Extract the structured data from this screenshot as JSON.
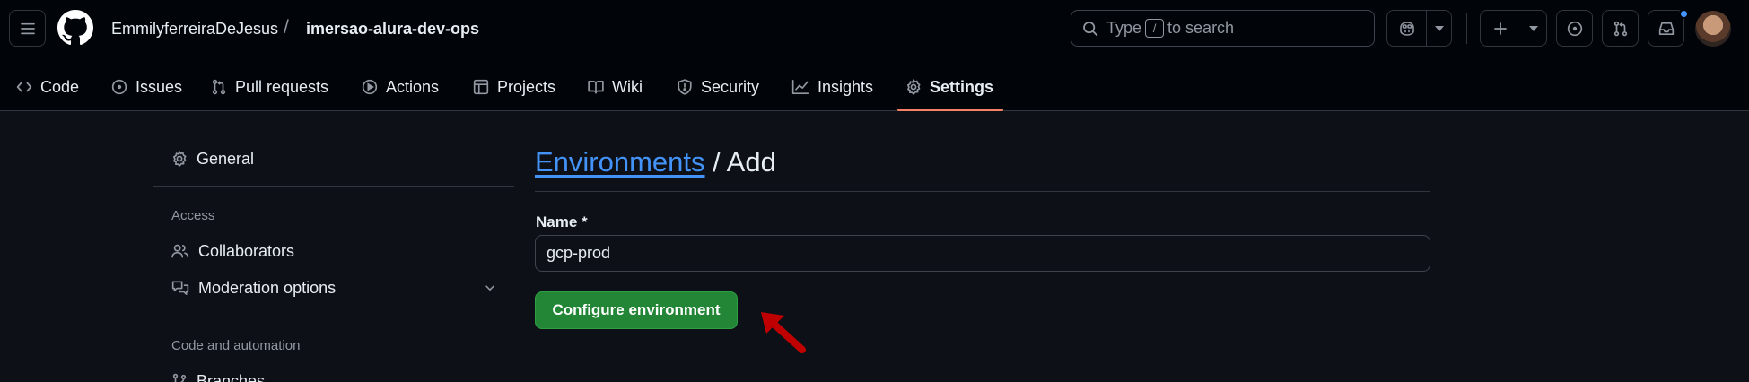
{
  "header": {
    "owner": "EmmilyferreiraDeJesus",
    "separator": "/",
    "repo": "imersao-alura-dev-ops",
    "search_prefix": "Type",
    "search_key": "/",
    "search_suffix": "to search"
  },
  "tabs": [
    {
      "label": "Code",
      "icon": "code-icon"
    },
    {
      "label": "Issues",
      "icon": "issue-opened-icon"
    },
    {
      "label": "Pull requests",
      "icon": "git-pull-request-icon"
    },
    {
      "label": "Actions",
      "icon": "play-icon"
    },
    {
      "label": "Projects",
      "icon": "table-icon"
    },
    {
      "label": "Wiki",
      "icon": "book-icon"
    },
    {
      "label": "Security",
      "icon": "shield-icon"
    },
    {
      "label": "Insights",
      "icon": "graph-icon"
    },
    {
      "label": "Settings",
      "icon": "gear-icon",
      "active": true
    }
  ],
  "sidebar": {
    "general": "General",
    "access_heading": "Access",
    "collaborators": "Collaborators",
    "moderation": "Moderation options",
    "code_heading": "Code and automation",
    "branches": "Branches"
  },
  "main": {
    "breadcrumb_link": "Environments",
    "breadcrumb_rest": " / Add",
    "name_label": "Name *",
    "name_value": "gcp-prod",
    "configure_button": "Configure environment"
  },
  "colors": {
    "accent_link": "#4493f8",
    "primary_button": "#238636",
    "active_tab_underline": "#f78166",
    "annotation_arrow": "#c00000"
  }
}
